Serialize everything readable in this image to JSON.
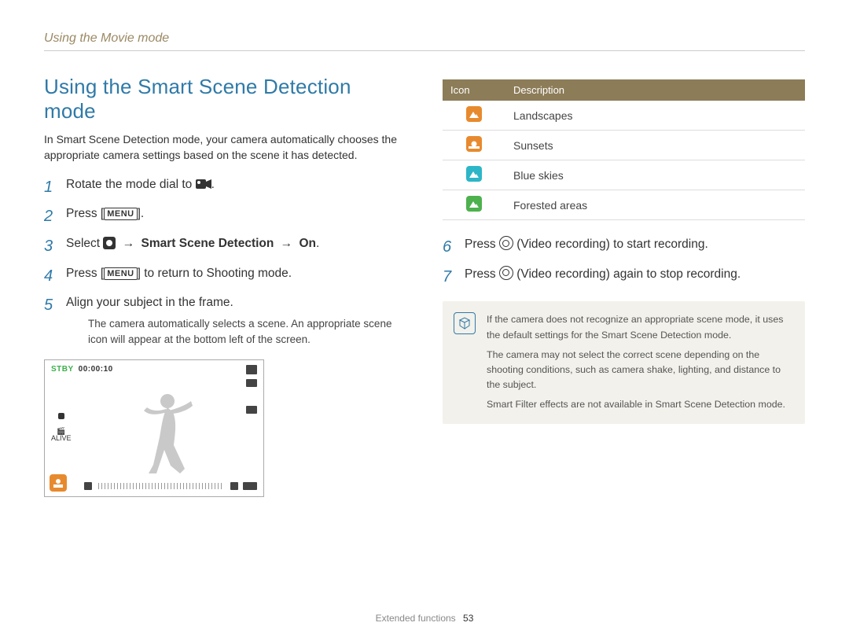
{
  "header": {
    "section": "Using the Movie mode"
  },
  "title": "Using the Smart Scene Detection mode",
  "intro": "In Smart Scene Detection mode, your camera automatically chooses the appropriate camera settings based on the scene it has detected.",
  "menu_label": "MENU",
  "steps_left": {
    "s1a": "Rotate the mode dial to ",
    "s1b": ".",
    "s2a": "Press [",
    "s2b": "].",
    "s3a": "Select ",
    "s3arrow": " → ",
    "s3b": "Smart Scene Detection",
    "s3c": "On",
    "s3d": ".",
    "s4a": "Press [",
    "s4b": "] to return to Shooting mode.",
    "s5": "Align your subject in the frame.",
    "s5_sub": "The camera automatically selects a scene. An appropriate scene icon will appear at the bottom left of the screen."
  },
  "preview": {
    "stby": "STBY",
    "time": "00:00:10",
    "alive": "ALIVE"
  },
  "icon_table": {
    "h1": "Icon",
    "h2": "Description",
    "rows": [
      {
        "label": "Landscapes",
        "color": "#e78a2e",
        "shape": "mountain"
      },
      {
        "label": "Sunsets",
        "color": "#e78a2e",
        "shape": "sunset"
      },
      {
        "label": "Blue skies",
        "color": "#2cb6c7",
        "shape": "mountain"
      },
      {
        "label": "Forested areas",
        "color": "#4db14d",
        "shape": "mountain"
      }
    ]
  },
  "steps_right": {
    "s6a": "Press ",
    "s6b": " (Video recording) to start recording.",
    "s7a": "Press ",
    "s7b": " (Video recording) again to stop recording."
  },
  "note": {
    "p1": "If the camera does not recognize an appropriate scene mode, it uses the default settings for the Smart Scene Detection mode.",
    "p2": "The camera may not select the correct scene depending on the shooting conditions, such as camera shake, lighting, and distance to the subject.",
    "p3": "Smart Filter effects are not available in Smart Scene Detection mode."
  },
  "footer": {
    "label": "Extended functions",
    "page": "53"
  }
}
